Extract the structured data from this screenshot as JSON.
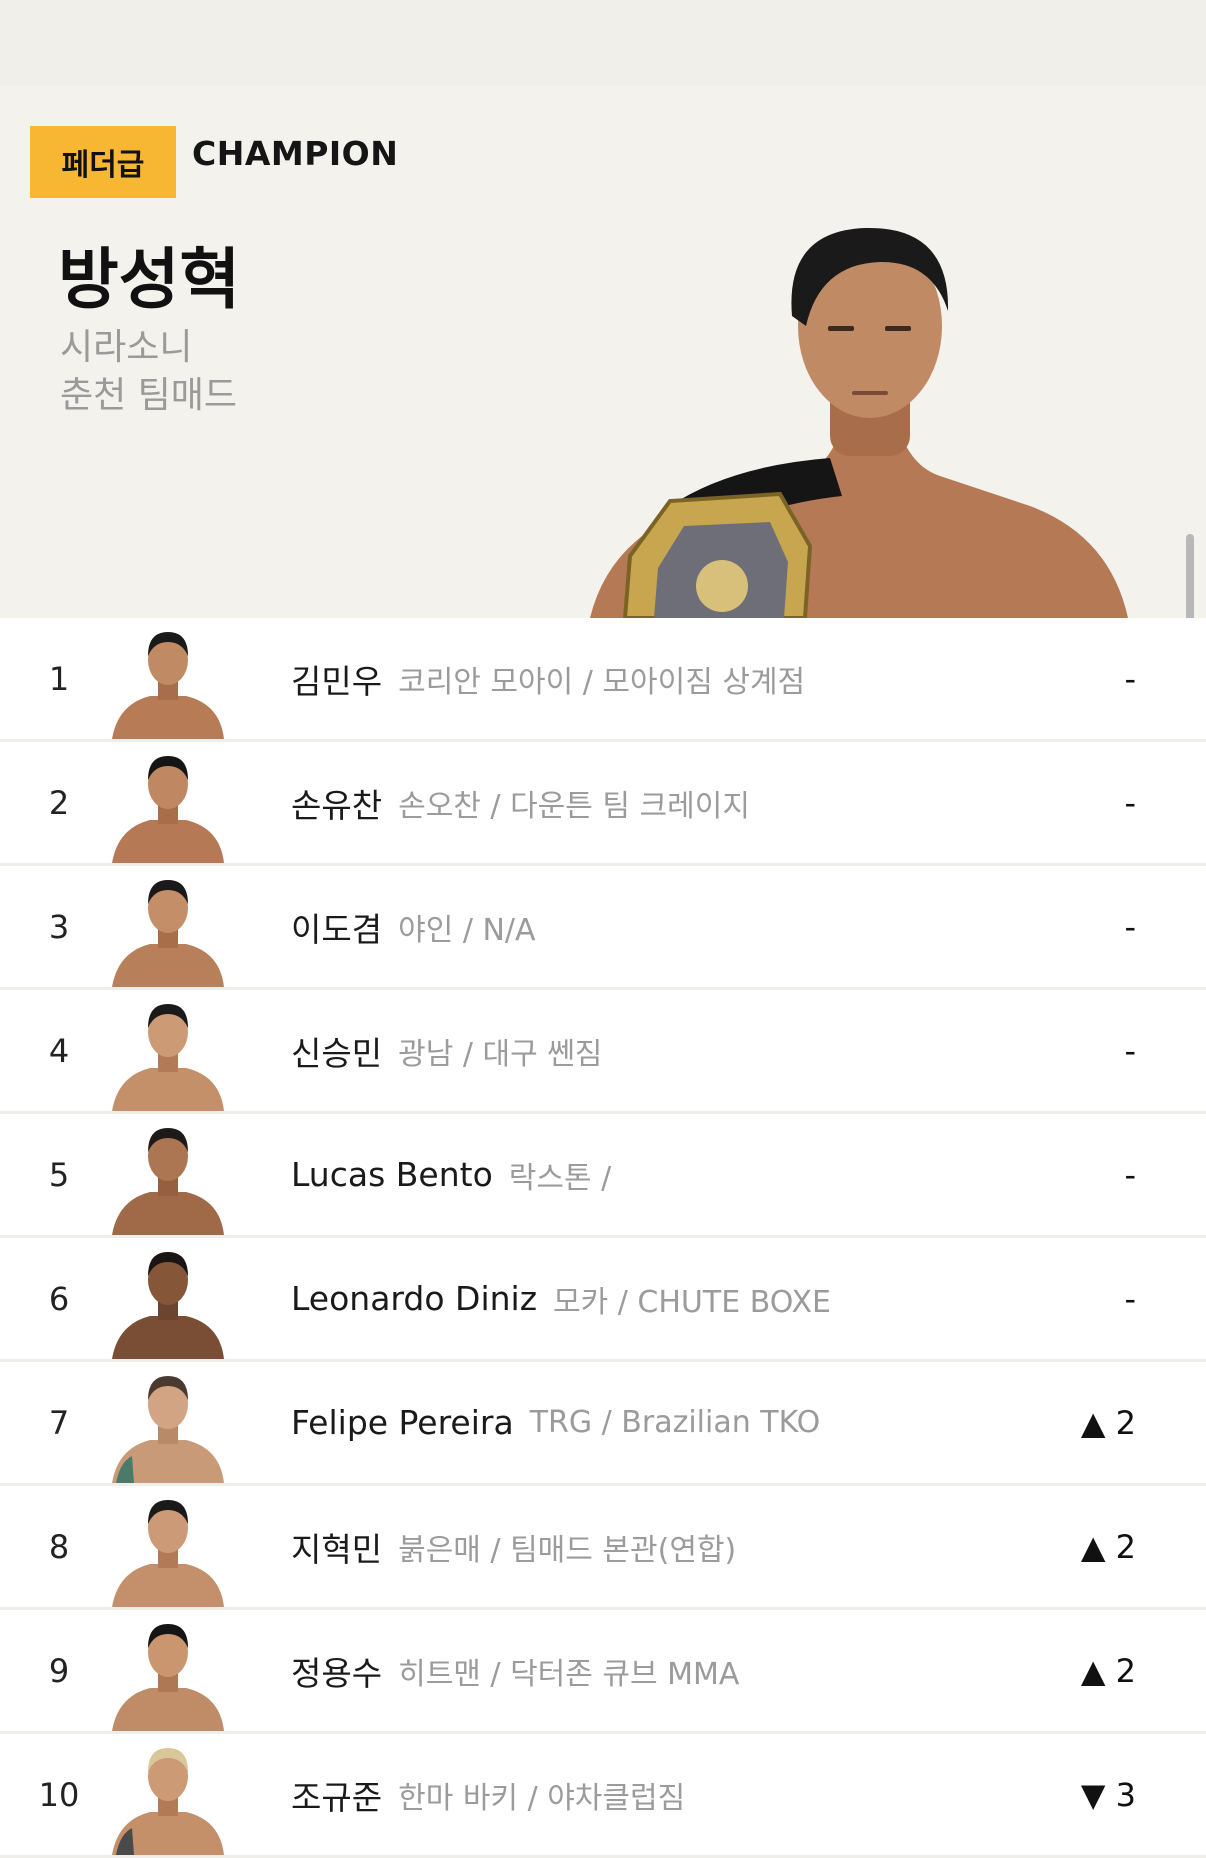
{
  "hero": {
    "weight_class": "페더급",
    "title": "CHAMPION",
    "champion": {
      "name": "방성혁",
      "nickname": "시라소니",
      "gym": "춘천 팀매드"
    }
  },
  "rankings": [
    {
      "rank": "1",
      "name": "김민우",
      "info": "코리안 모아이 / 모아이짐 상계점",
      "change": "-"
    },
    {
      "rank": "2",
      "name": "손유찬",
      "info": "손오찬 / 다운튼 팀 크레이지",
      "change": "-"
    },
    {
      "rank": "3",
      "name": "이도겸",
      "info": "야인 / N/A",
      "change": "-"
    },
    {
      "rank": "4",
      "name": "신승민",
      "info": "광남 / 대구 쎈짐",
      "change": "-"
    },
    {
      "rank": "5",
      "name": "Lucas Bento",
      "info": "락스톤 /",
      "change": "-"
    },
    {
      "rank": "6",
      "name": "Leonardo Diniz",
      "info": "모카 / CHUTE BOXE",
      "change": "-"
    },
    {
      "rank": "7",
      "name": "Felipe Pereira",
      "info": "TRG / Brazilian TKO",
      "change": "▲ 2"
    },
    {
      "rank": "8",
      "name": "지혁민",
      "info": "붉은매 / 팀매드 본관(연합)",
      "change": "▲ 2"
    },
    {
      "rank": "9",
      "name": "정용수",
      "info": "히트맨 / 닥터존 큐브 MMA",
      "change": "▲ 2"
    },
    {
      "rank": "10",
      "name": "조규준",
      "info": "한마 바키 / 야차클럽짐",
      "change": "▼ 3"
    }
  ],
  "colors": {
    "badge": "#f7b733",
    "hero_bg": "#f4f2ed",
    "muted_text": "#9b9b9b",
    "divider": "#f0eeea"
  }
}
